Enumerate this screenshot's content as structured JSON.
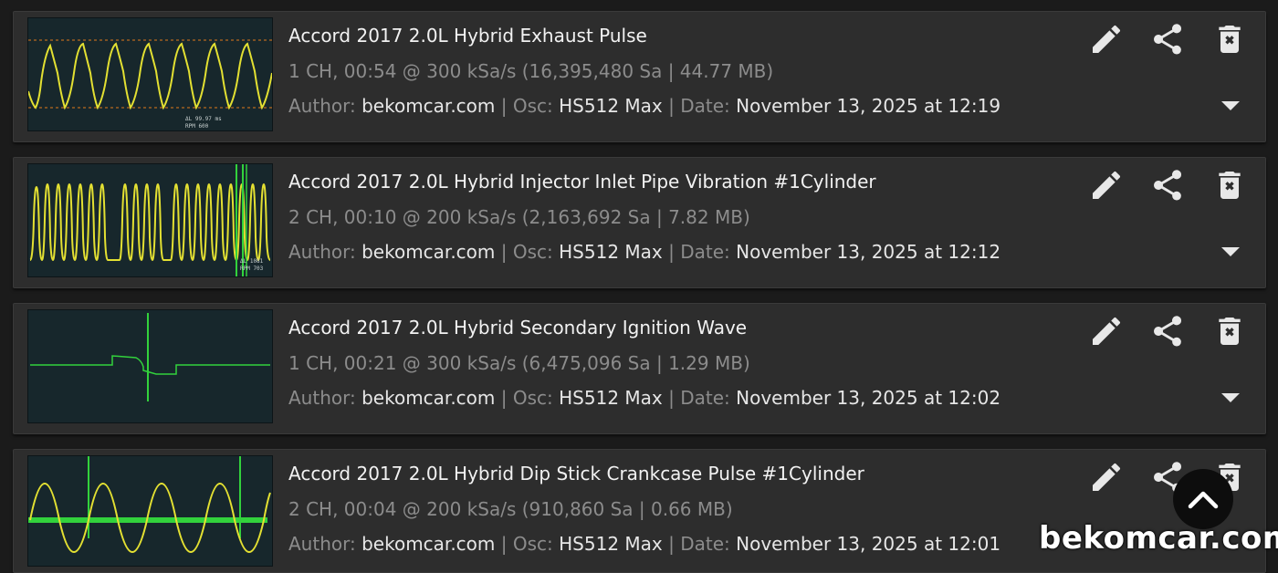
{
  "recordings": [
    {
      "title": "Accord 2017 2.0L Hybrid Exhaust Pulse",
      "meta": "1 CH, 00:54 @ 300 kSa/s (16,395,480 Sa | 44.77 MB)",
      "author_label": "Author:",
      "author": "bekomcar.com",
      "osc_label": "Osc:",
      "osc": "HS512 Max",
      "date_label": "Date:",
      "date": "November 13, 2025 at 12:19",
      "thumb_readout": [
        "ΔL 99.97 ms",
        "RPM 600"
      ]
    },
    {
      "title": "Accord 2017 2.0L Hybrid Injector Inlet Pipe Vibration #1Cylinder",
      "meta": "2 CH, 00:10 @ 200 kSa/s (2,163,692 Sa | 7.82 MB)",
      "author_label": "Author:",
      "author": "bekomcar.com",
      "osc_label": "Osc:",
      "osc": "HS512 Max",
      "date_label": "Date:",
      "date": "November 13, 2025 at 12:12",
      "thumb_readout": [
        "ΔL 1081",
        "RPM 703"
      ]
    },
    {
      "title": "Accord 2017 2.0L Hybrid Secondary Ignition Wave",
      "meta": "1 CH, 00:21 @ 300 kSa/s (6,475,096 Sa | 1.29 MB)",
      "author_label": "Author:",
      "author": "bekomcar.com",
      "osc_label": "Osc:",
      "osc": "HS512 Max",
      "date_label": "Date:",
      "date": "November 13, 2025 at 12:02",
      "thumb_readout": []
    },
    {
      "title": "Accord 2017 2.0L Hybrid Dip Stick Crankcase Pulse #1Cylinder",
      "meta": "2 CH, 00:04 @ 200 kSa/s (910,860 Sa | 0.66 MB)",
      "author_label": "Author:",
      "author": "bekomcar.com",
      "osc_label": "Osc:",
      "osc": "HS512 Max",
      "date_label": "Date:",
      "date": "November 13, 2025 at 12:01",
      "thumb_readout": []
    }
  ],
  "icons": {
    "edit": "pencil-icon",
    "share": "share-icon",
    "delete": "trash-icon",
    "expand": "caret-down-icon",
    "scroll_top": "chevron-up-icon"
  },
  "colors": {
    "ch1": "#e3e032",
    "ch2": "#32d23c",
    "screen_bg": "#17272c",
    "card_bg": "#2d2d2d",
    "icon": "#e8e8e8"
  },
  "watermark": "bekomcar.com"
}
